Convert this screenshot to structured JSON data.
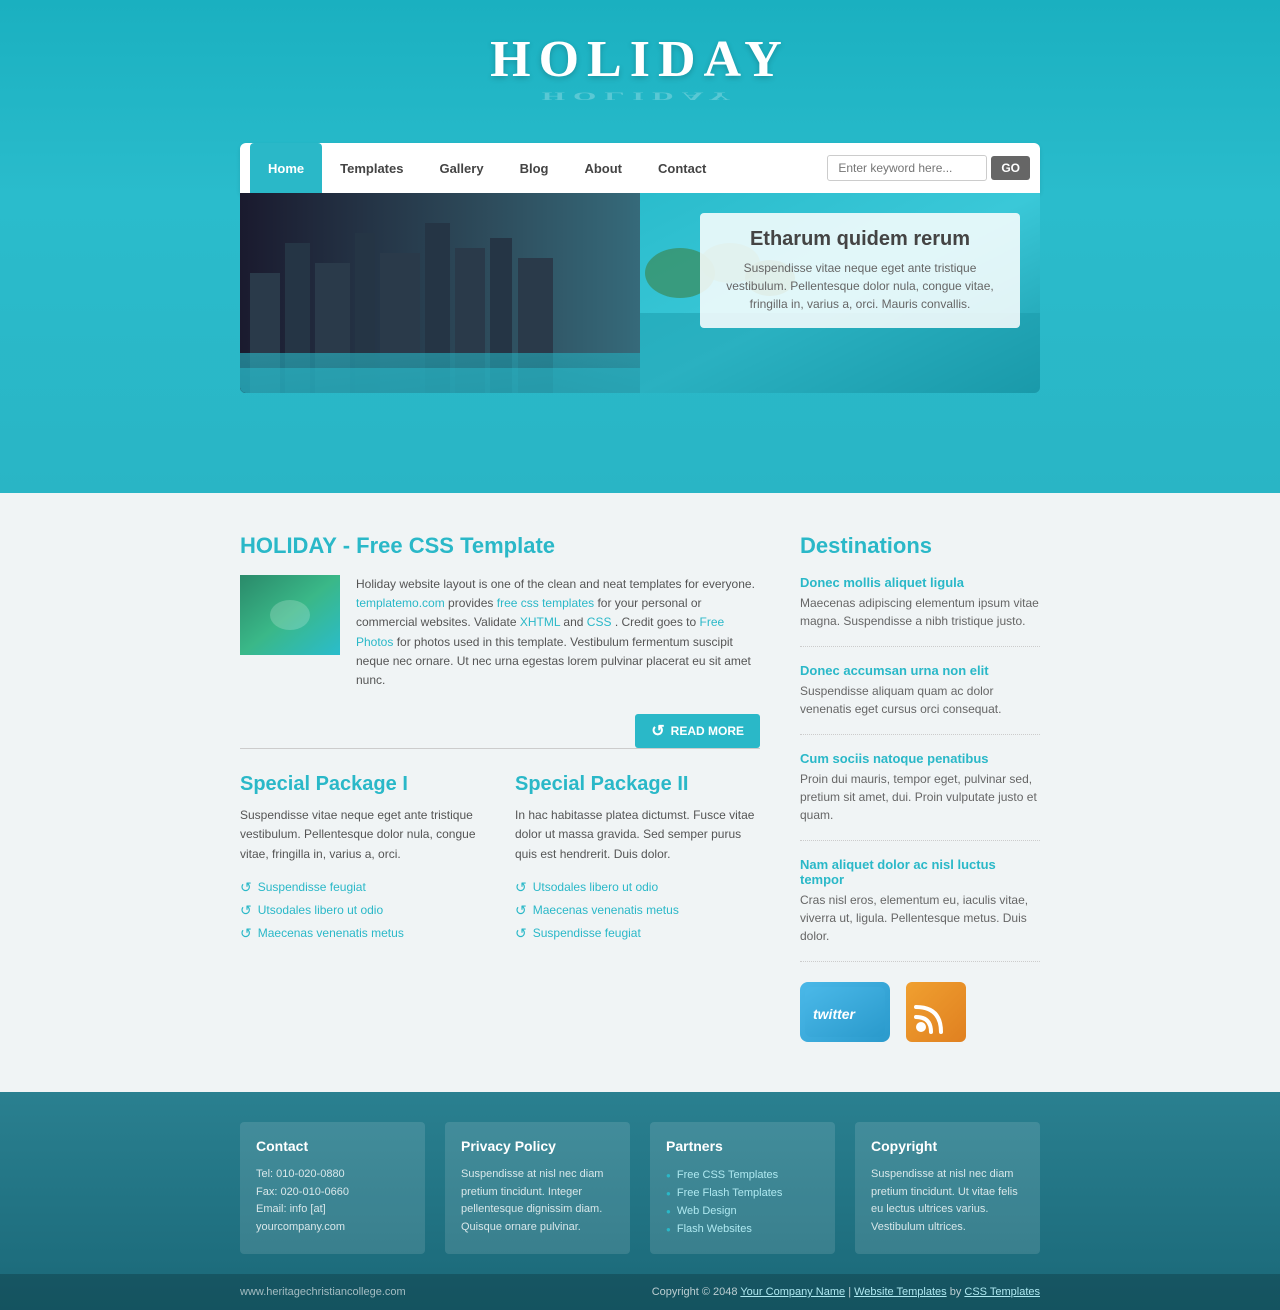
{
  "site": {
    "title": "HOLIDAY",
    "title_reflection": "HOLIDAY",
    "url": "www.heritagechristiancollege.com"
  },
  "nav": {
    "home": "Home",
    "templates": "Templates",
    "gallery": "Gallery",
    "blog": "Blog",
    "about": "About",
    "contact": "Contact",
    "search_placeholder": "Enter keyword here...",
    "search_btn": "GO"
  },
  "hero": {
    "heading": "Etharum quidem rerum",
    "text": "Suspendisse vitae neque eget ante tristique vestibulum. Pellentesque dolor nula, congue vitae, fringilla in, varius a, orci. Mauris convallis."
  },
  "main": {
    "title": "HOLIDAY - Free CSS Template",
    "body": "Holiday website layout is one of the clean and neat templates for everyone.",
    "body2": " provides ",
    "link1": "templatemo.com",
    "link2": "free css templates",
    "body3": " for your personal or commercial websites. Validate ",
    "link3": "XHTML",
    "body4": " and ",
    "link4": "CSS",
    "body5": ". Credit goes to ",
    "link5": "Free Photos",
    "body6": " for photos used in this template. Vestibulum fermentum suscipit neque nec ornare. Ut nec urna egestas lorem pulvinar placerat eu sit amet nunc.",
    "read_more": "READ MORE"
  },
  "packages": [
    {
      "title": "Special Package I",
      "text": "Suspendisse vitae neque eget ante tristique vestibulum. Pellentesque dolor nula, congue vitae, fringilla in, varius a, orci.",
      "items": [
        "Suspendisse feugiat",
        "Utsodales libero ut odio",
        "Maecenas venenatis metus"
      ]
    },
    {
      "title": "Special Package II",
      "text": "In hac habitasse platea dictumst. Fusce vitae dolor ut massa gravida. Sed semper purus quis est hendrerit. Duis dolor.",
      "items": [
        "Utsodales libero ut odio",
        "Maecenas venenatis metus",
        "Suspendisse feugiat"
      ]
    }
  ],
  "sidebar": {
    "title": "Destinations",
    "items": [
      {
        "link": "Donec mollis aliquet ligula",
        "text": "Maecenas adipiscing elementum ipsum vitae magna. Suspendisse a nibh tristique justo."
      },
      {
        "link": "Donec accumsan urna non elit",
        "text": "Suspendisse aliquam quam ac dolor venenatis eget cursus orci consequat."
      },
      {
        "link": "Cum sociis natoque penatibus",
        "text": "Proin dui mauris, tempor eget, pulvinar sed, pretium sit amet, dui. Proin vulputate justo et quam."
      },
      {
        "link": "Nam aliquet dolor ac nisl luctus tempor",
        "text": "Cras nisl eros, elementum eu, iaculis vitae, viverra ut, ligula. Pellentesque metus. Duis dolor."
      }
    ],
    "twitter_label": "twitter",
    "rss_symbol": "◉"
  },
  "footer": {
    "cols": [
      {
        "title": "Contact",
        "lines": [
          "Tel: 010-020-0880",
          "Fax: 020-010-0660",
          "Email: info [at] yourcompany.com"
        ]
      },
      {
        "title": "Privacy Policy",
        "text": "Suspendisse at nisl nec diam pretium tincidunt. Integer pellentesque dignissim diam. Quisque ornare pulvinar."
      },
      {
        "title": "Partners",
        "links": [
          "Free CSS Templates",
          "Free Flash Templates",
          "Web Design",
          "Flash Websites"
        ]
      },
      {
        "title": "Copyright",
        "text": "Suspendisse at nisl nec diam pretium tincidunt. Ut vitae felis eu lectus ultrices varius. Vestibulum ultrices."
      }
    ],
    "copyright": "Copyright © 2048",
    "company_link": "Your Company Name",
    "sep": "|",
    "wt_link": "Website Templates",
    "by": "by",
    "css_link": "CSS Templates"
  }
}
